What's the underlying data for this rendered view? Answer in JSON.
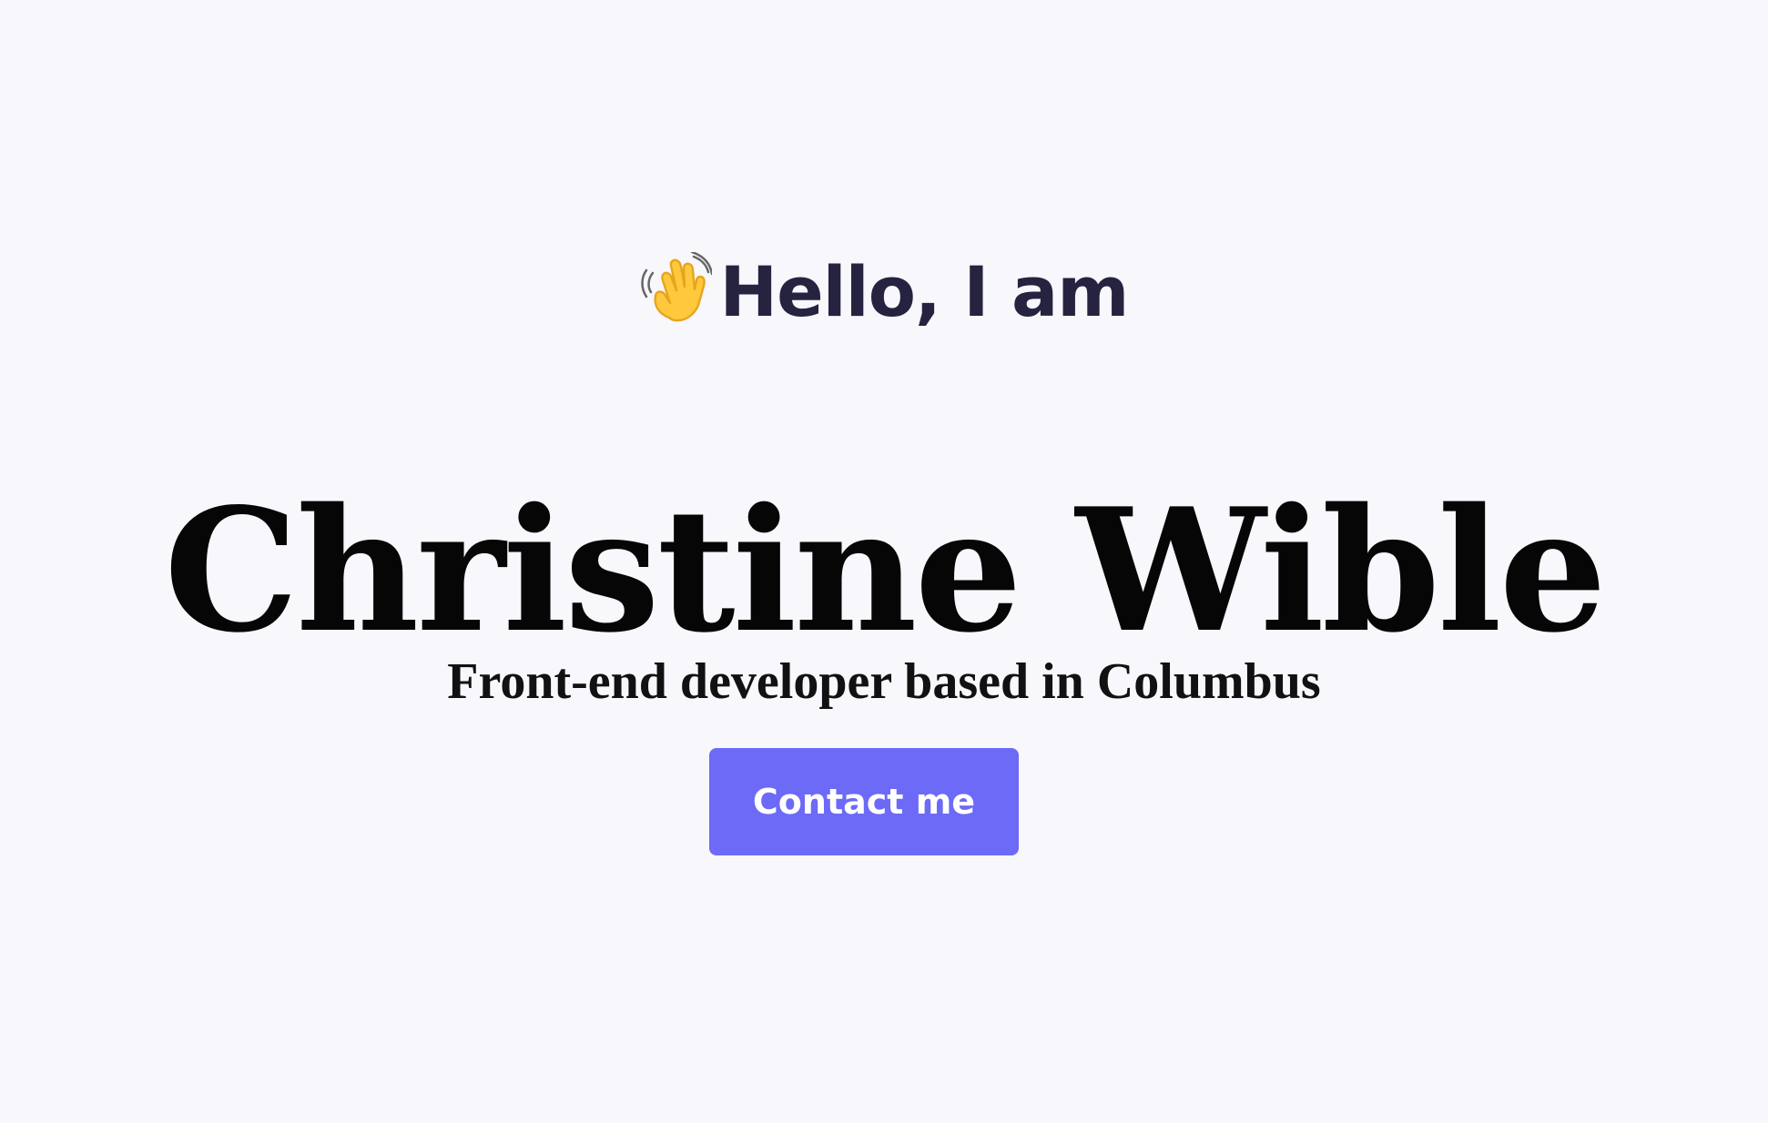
{
  "hero": {
    "greeting": "Hello, I am",
    "greeting_icon": "waving-hand-icon",
    "name": "Christine Wible",
    "subtitle": "Front-end developer based in Columbus",
    "button_label": "Contact me"
  },
  "colors": {
    "background": "#f7f7fc",
    "greeting_text": "#25233f",
    "name_text": "#060606",
    "subtitle_text": "#111111",
    "button_background": "#6c6af6",
    "button_text": "#ffffff",
    "wave_hand": "#ffc83d",
    "wave_hand_outline": "#e7a51c"
  }
}
